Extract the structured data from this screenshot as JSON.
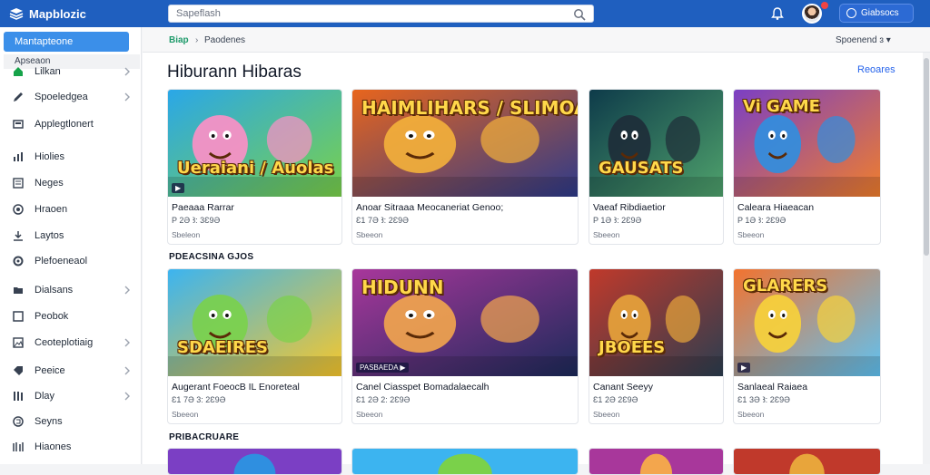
{
  "app": {
    "name": "Mapblozic"
  },
  "search": {
    "placeholder": "Sapeflash"
  },
  "account": {
    "label": "Giabsocs"
  },
  "sidebar": {
    "active": "Mantapteone",
    "subheader": "Apseaon",
    "items": [
      {
        "label": "Lilkan",
        "icon": "home-icon",
        "chevron": true
      },
      {
        "label": "Spoeledgea",
        "icon": "pen-icon",
        "chevron": true
      },
      {
        "label": "Applegtlonert",
        "icon": "app-icon",
        "chevron": false
      },
      {
        "label": "Hiolies",
        "icon": "chart-icon",
        "chevron": false
      },
      {
        "label": "Neges",
        "icon": "news-icon",
        "chevron": false
      },
      {
        "label": "Hraoen",
        "icon": "globe-icon",
        "chevron": false
      },
      {
        "label": "Laytos",
        "icon": "download-icon",
        "chevron": false
      },
      {
        "label": "Plefoeneaol",
        "icon": "settings-icon",
        "chevron": false
      },
      {
        "label": "Dialsans",
        "icon": "folder-icon",
        "chevron": true
      },
      {
        "label": "Peobok",
        "icon": "book-icon",
        "chevron": false
      },
      {
        "label": "Ceoteplotiaig",
        "icon": "image-icon",
        "chevron": true
      },
      {
        "label": "Peeice",
        "icon": "tag-icon",
        "chevron": true
      },
      {
        "label": "Dlay",
        "icon": "library-icon",
        "chevron": true
      },
      {
        "label": "Seyns",
        "icon": "mail-icon",
        "chevron": false
      },
      {
        "label": "Hiaones",
        "icon": "grid-icon",
        "chevron": false
      }
    ]
  },
  "breadcrumb": {
    "home": "Biap",
    "separator": "›",
    "current": "Paodenes"
  },
  "sort": {
    "label": "Spoenend ɜ ▾"
  },
  "page": {
    "title": "Hiburann Hibaras",
    "featured": "Reoares"
  },
  "sections": [
    {
      "title": "PDEACSINA GJOS"
    },
    {
      "title": "PRIBACRUARE"
    }
  ],
  "cards_row1": [
    {
      "title": "Paeaaa Rarrar",
      "meta": "P 2Ə Ꜣ: 3Ɛ9Ə",
      "sub": "Sbeleon",
      "art": "Ueraiani / Auolas",
      "badge": "▶"
    },
    {
      "title": "Anoar Sitraaa Meocaneriat Genoo;",
      "meta": "Ɛ1 7Ə Ꜣ: 2Ɛ9Ə",
      "sub": "Sbeeon",
      "art": "HAIMLIHARS / SLIMOAS",
      "badge": ""
    },
    {
      "title": "Vaeaf Ribdiaetior",
      "meta": "P 1Ə Ꜣ: 2Ɛ9Ə",
      "sub": "Sbeeon",
      "art": "GAUSATS",
      "badge": ""
    },
    {
      "title": "Caleara Hiaeacan",
      "meta": "P 1Ə Ꜣ: 2Ɛ9Ə",
      "sub": "Sbeeon",
      "art": "Vi GAME",
      "badge": ""
    }
  ],
  "cards_row2": [
    {
      "title": "Augerant FoeocB IL Enoreteal",
      "meta": "Ɛ1 7Ə 3: 2Ɛ9Ə",
      "sub": "Sbeeon",
      "art": "SDAEIRES",
      "badge": ""
    },
    {
      "title": "Canel Ciasspet Bomadalaecalh",
      "meta": "Ɛ1 2Ə 2: 2Ɛ9Ə",
      "sub": "Sbeeon",
      "art": "HIDUNN",
      "badge": "PASBAEDA ▶"
    },
    {
      "title": "Canant Seeyy",
      "meta": "Ɛ1 2Ə 2Ɛ9Ə",
      "sub": "Sbeeon",
      "art": "JBOEES",
      "badge": ""
    },
    {
      "title": "Sanlaeal Raiaea",
      "meta": "Ɛ1 3Ə Ꜣ: 2Ɛ9Ə",
      "sub": "Sbeeon",
      "art": "GLARERS",
      "badge": "▶"
    }
  ],
  "colors": {
    "topbar": "#1f5fbf",
    "accent": "#3b8fe9",
    "link": "#2563eb"
  }
}
